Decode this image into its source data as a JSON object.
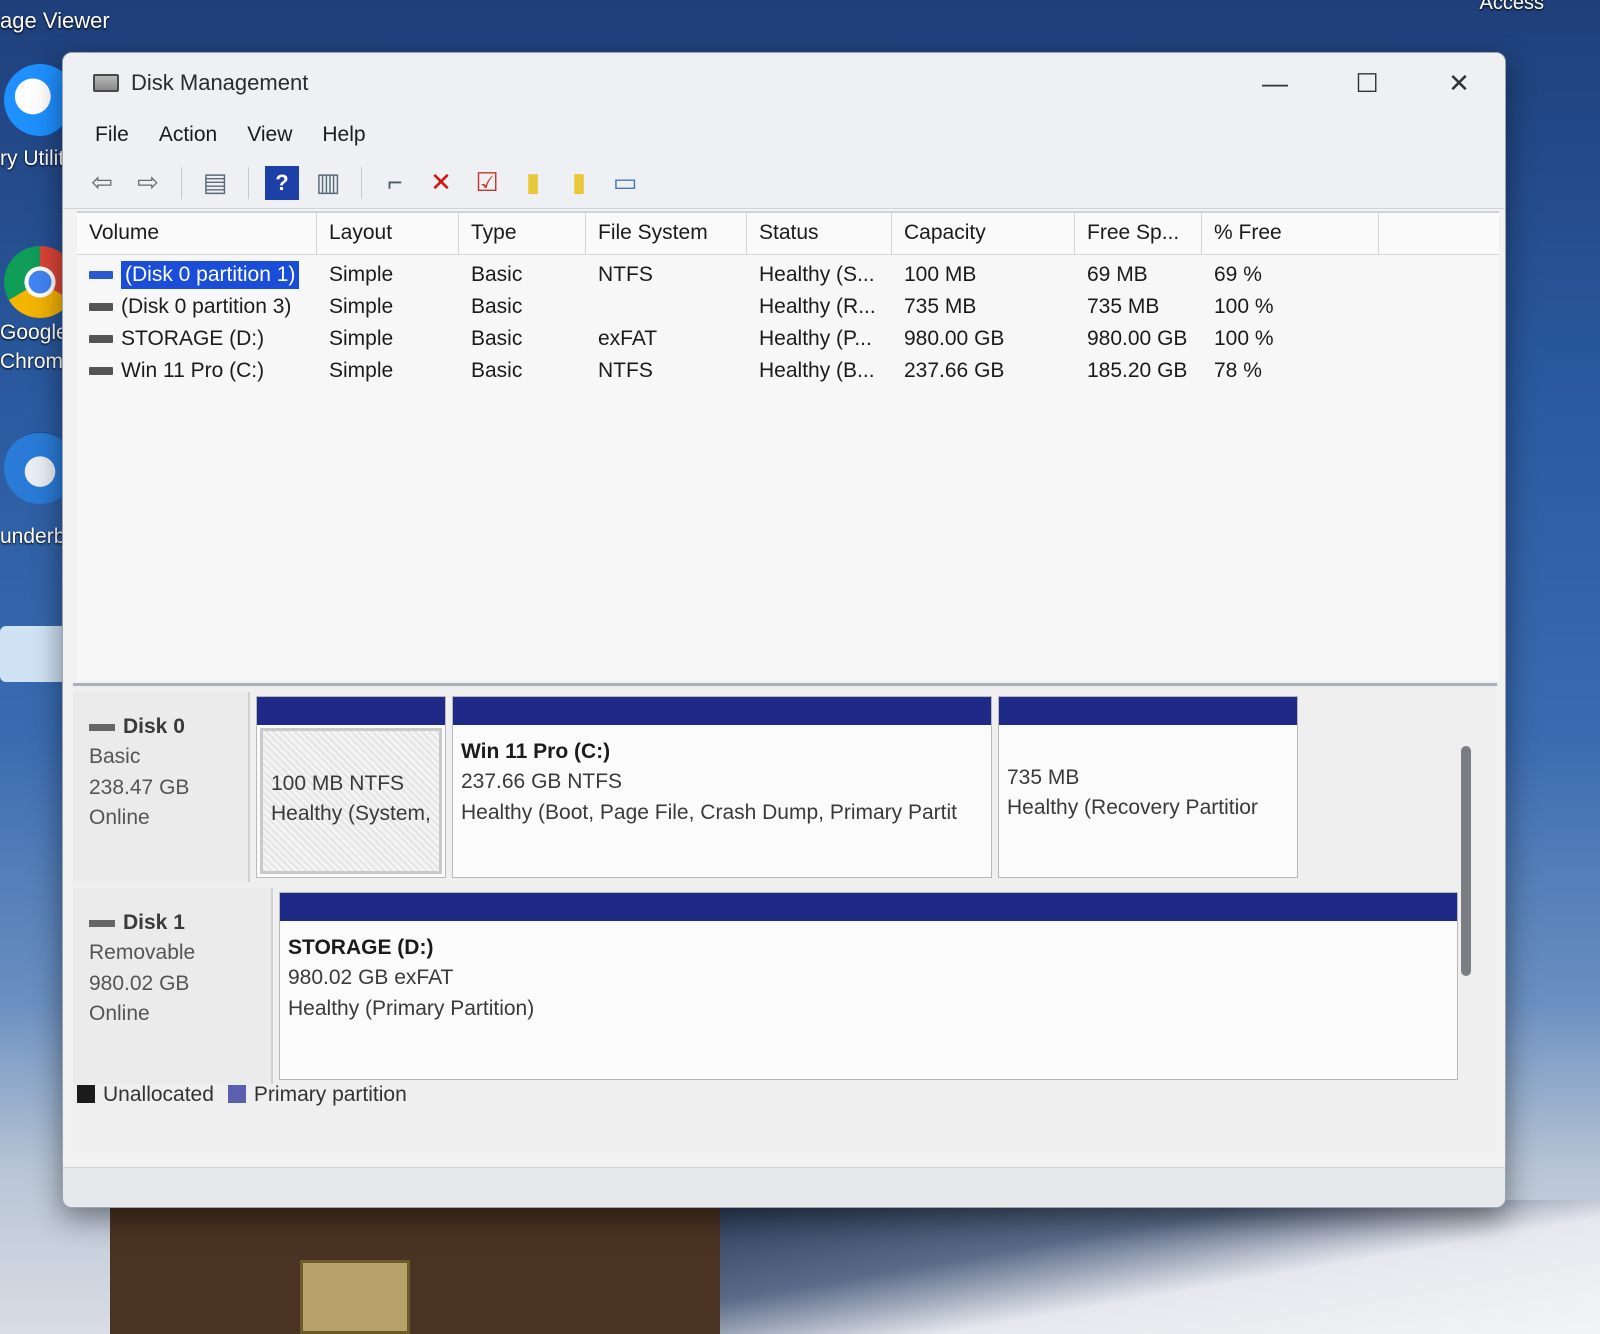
{
  "desktop": {
    "top_left_label": "age Viewer",
    "top_right_label": "Access",
    "icons": [
      {
        "label": "ry Utilit",
        "name": "utility-shortcut",
        "color": "#1e90ff"
      },
      {
        "label": "Google Chrome",
        "name": "chrome-shortcut",
        "color": "#db4437"
      },
      {
        "label": "underbi",
        "name": "thunderbird-shortcut",
        "color": "#2a7bd8"
      }
    ]
  },
  "window": {
    "title": "Disk Management",
    "controls": {
      "minimize": "—",
      "maximize": "☐",
      "close": "✕"
    }
  },
  "menu": [
    "File",
    "Action",
    "View",
    "Help"
  ],
  "toolbar": [
    {
      "icon": "back-arrow-icon",
      "glyph": "⇦"
    },
    {
      "icon": "forward-arrow-icon",
      "glyph": "⇨"
    },
    {
      "icon": "console-tree-icon",
      "glyph": "▤"
    },
    {
      "icon": "help-icon",
      "glyph": "?"
    },
    {
      "icon": "view-icon",
      "glyph": "▥"
    },
    {
      "icon": "connect-icon",
      "glyph": "⌐"
    },
    {
      "icon": "delete-icon",
      "glyph": "✕"
    },
    {
      "icon": "properties-icon",
      "glyph": "☑"
    },
    {
      "icon": "folder-up-icon",
      "glyph": "▮"
    },
    {
      "icon": "folder-search-icon",
      "glyph": "▮"
    },
    {
      "icon": "window-icon",
      "glyph": "▭"
    }
  ],
  "columns": [
    "Volume",
    "Layout",
    "Type",
    "File System",
    "Status",
    "Capacity",
    "Free Sp...",
    "% Free"
  ],
  "volumes": [
    {
      "volume": "(Disk 0 partition 1)",
      "layout": "Simple",
      "type": "Basic",
      "fs": "NTFS",
      "status": "Healthy (S...",
      "capacity": "100 MB",
      "free": "69 MB",
      "pct": "69 %",
      "selected": true
    },
    {
      "volume": "(Disk 0 partition 3)",
      "layout": "Simple",
      "type": "Basic",
      "fs": "",
      "status": "Healthy (R...",
      "capacity": "735 MB",
      "free": "735 MB",
      "pct": "100 %",
      "selected": false
    },
    {
      "volume": "STORAGE (D:)",
      "layout": "Simple",
      "type": "Basic",
      "fs": "exFAT",
      "status": "Healthy (P...",
      "capacity": "980.00 GB",
      "free": "980.00 GB",
      "pct": "100 %",
      "selected": false
    },
    {
      "volume": "Win 11 Pro (C:)",
      "layout": "Simple",
      "type": "Basic",
      "fs": "NTFS",
      "status": "Healthy (B...",
      "capacity": "237.66 GB",
      "free": "185.20 GB",
      "pct": "78 %",
      "selected": false
    }
  ],
  "disks": [
    {
      "name": "Disk 0",
      "kind": "Basic",
      "size": "238.47 GB",
      "state": "Online",
      "partitions": [
        {
          "title": "",
          "line1": "100 MB NTFS",
          "line2": "Healthy (System,",
          "hatched": true
        },
        {
          "title": "Win 11 Pro  (C:)",
          "line1": "237.66 GB NTFS",
          "line2": "Healthy (Boot, Page File, Crash Dump, Primary Partit",
          "hatched": false
        },
        {
          "title": "",
          "line1": "735 MB",
          "line2": "Healthy (Recovery Partitior",
          "hatched": false
        }
      ]
    },
    {
      "name": "Disk 1",
      "kind": "Removable",
      "size": "980.02 GB",
      "state": "Online",
      "partitions": [
        {
          "title": "STORAGE  (D:)",
          "line1": "980.02 GB exFAT",
          "line2": "Healthy (Primary Partition)",
          "hatched": false
        }
      ]
    }
  ],
  "legend": [
    {
      "label": "Unallocated",
      "color": "#1b1b1b"
    },
    {
      "label": "Primary partition",
      "color": "#5a5fb0"
    }
  ],
  "colors": {
    "partition_bar": "#1f2a88",
    "selection": "#1a4ed8"
  }
}
